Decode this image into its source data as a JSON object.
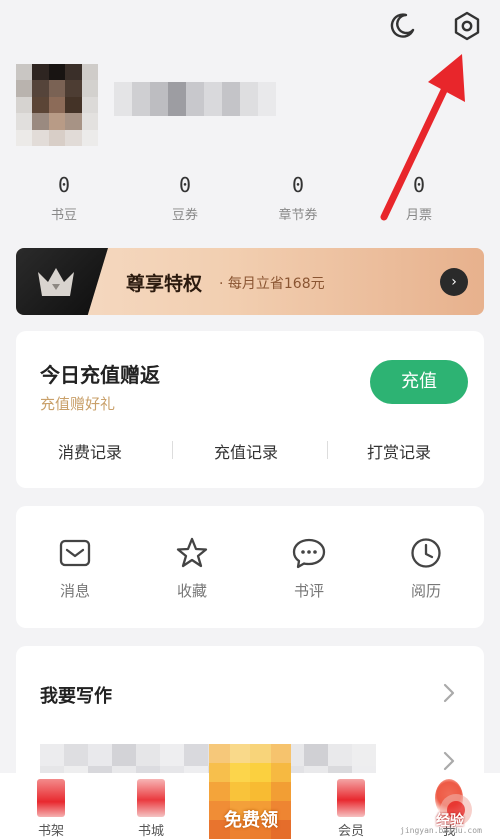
{
  "header": {
    "icons": [
      "moon-icon",
      "settings-gear-icon"
    ]
  },
  "profile": {
    "username": ""
  },
  "stats": [
    {
      "value": "0",
      "label": "书豆"
    },
    {
      "value": "0",
      "label": "豆券"
    },
    {
      "value": "0",
      "label": "章节券"
    },
    {
      "value": "0",
      "label": "月票"
    }
  ],
  "vip": {
    "title": "尊享特权",
    "subtitle": "· 每月立省168元",
    "colors": {
      "dark": "#1a1a1a",
      "gold": "#f2cfb1",
      "text": "#8a5532"
    }
  },
  "recharge": {
    "title": "今日充值赠返",
    "subtitle": "充值赠好礼",
    "button": "充值",
    "button_color": "#2db373",
    "links": [
      "消费记录",
      "充值记录",
      "打赏记录"
    ]
  },
  "quick": [
    {
      "label": "消息",
      "icon": "message-icon"
    },
    {
      "label": "收藏",
      "icon": "star-icon"
    },
    {
      "label": "书评",
      "icon": "comment-icon"
    },
    {
      "label": "阅历",
      "icon": "clock-icon"
    }
  ],
  "writing": {
    "title": "我要写作"
  },
  "tabbar": {
    "tabs": [
      {
        "label": "书架"
      },
      {
        "label": "书城"
      },
      {
        "label": "会员"
      },
      {
        "label": "我"
      }
    ],
    "center": "免费领"
  },
  "watermark": {
    "text": "经验",
    "url": "jingyan.baidu.com"
  }
}
